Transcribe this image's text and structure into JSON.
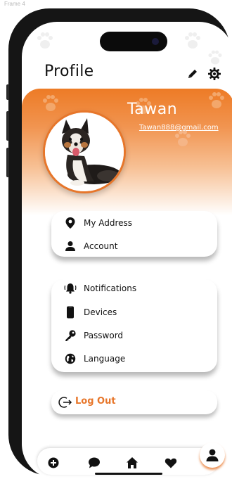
{
  "frame_label": "Frame 4",
  "header": {
    "title": "Profile",
    "edit_icon": "pencil-icon",
    "settings_icon": "gear-icon"
  },
  "user": {
    "name": "Tawan",
    "email": "Tawan888@gmail.com",
    "avatar": "dog-photo"
  },
  "account_card": {
    "items": [
      {
        "label": "My Address",
        "icon": "location-pin-icon"
      },
      {
        "label": "Account",
        "icon": "person-icon"
      }
    ]
  },
  "settings_card": {
    "items": [
      {
        "label": "Notifications",
        "icon": "bell-icon"
      },
      {
        "label": "Devices",
        "icon": "phone-device-icon"
      },
      {
        "label": "Password",
        "icon": "key-icon"
      },
      {
        "label": "Language",
        "icon": "globe-icon"
      }
    ]
  },
  "logout": {
    "label": "Log Out",
    "icon": "logout-icon"
  },
  "tabbar": {
    "tabs": [
      {
        "icon": "add-icon"
      },
      {
        "icon": "chat-icon"
      },
      {
        "icon": "home-icon"
      },
      {
        "icon": "heart-icon"
      },
      {
        "icon": "person-icon",
        "active": true
      }
    ]
  },
  "colors": {
    "accent": "#e7762a",
    "accent_light": "#f7c094",
    "text": "#111111",
    "background": "#ffffff"
  }
}
